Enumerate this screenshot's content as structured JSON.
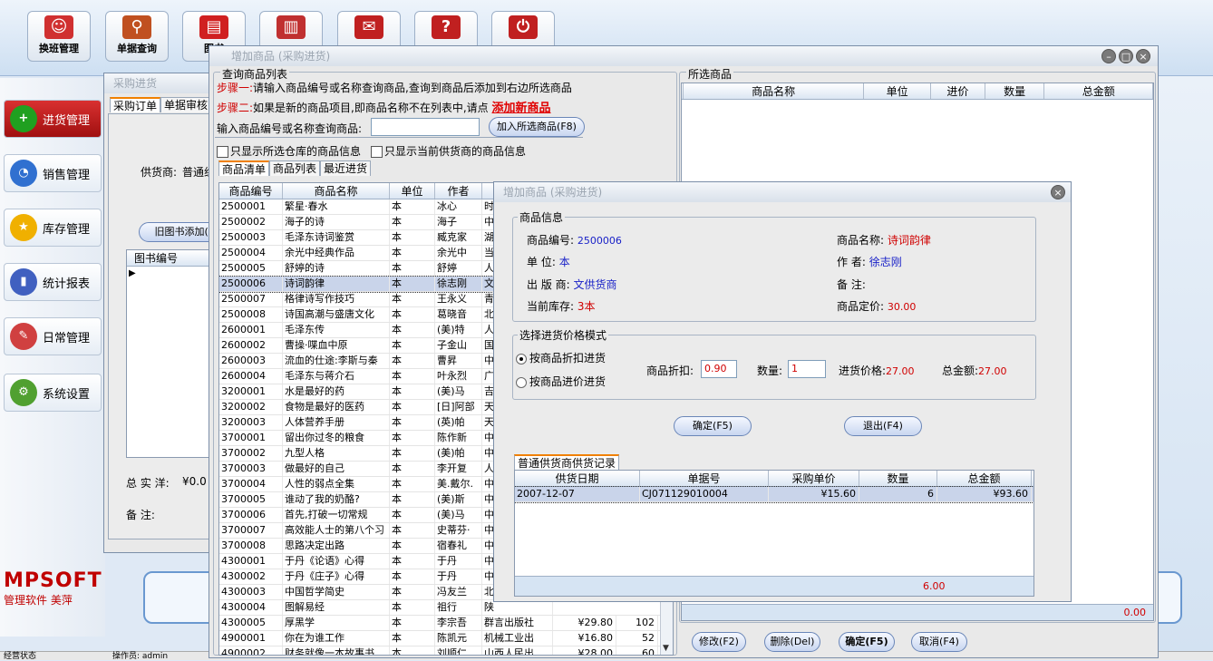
{
  "toolbar": [
    {
      "label": "换班管理",
      "icon": "user-icon",
      "color": "#d03030"
    },
    {
      "label": "单据查询",
      "icon": "search-icon",
      "color": "#c05020"
    },
    {
      "label": "图书",
      "icon": "book-icon",
      "color": "#d02020"
    },
    {
      "label": "",
      "icon": "chart-icon",
      "color": "#c03030"
    },
    {
      "label": "",
      "icon": "mail-icon",
      "color": "#c02020"
    },
    {
      "label": "",
      "icon": "help-icon",
      "color": "#c02020"
    },
    {
      "label": "",
      "icon": "power-icon",
      "color": "#c02020"
    }
  ],
  "sidebar": [
    {
      "label": "进货管理",
      "icon": "plus-icon",
      "color": "#20a020"
    },
    {
      "label": "销售管理",
      "icon": "pie-chart-icon",
      "color": "#3070d0"
    },
    {
      "label": "库存管理",
      "icon": "star-icon",
      "color": "#f0b000"
    },
    {
      "label": "统计报表",
      "icon": "bar-chart-icon",
      "color": "#4060c0"
    },
    {
      "label": "日常管理",
      "icon": "tools-icon",
      "color": "#d04040"
    },
    {
      "label": "系统设置",
      "icon": "gear-icon",
      "color": "#50a030"
    }
  ],
  "brand": {
    "logo": "MPSOFT",
    "subtitle": "管理软件 美萍"
  },
  "purchase": {
    "title": "采购进货",
    "tab1": "采购订单",
    "tab2": "单据审核",
    "supplier_label": "供货商:",
    "supplier_value": "普通组",
    "add_btn": "旧图书添加(F9)",
    "col_code": "图书编号",
    "total_label": "总 实 洋:",
    "total_value": "¥0.0",
    "note_label": "备     注:"
  },
  "status": {
    "left": "经营状态",
    "mid": "操作员: admin"
  },
  "add": {
    "title": "增加商品 (采购进货)",
    "query_group": "查询商品列表",
    "step1": "步骤一:",
    "step1_text": "请输入商品编号或名称查询商品,查询到商品后添加到右边所选商品",
    "step2": "步骤二:",
    "step2_text": "如果是新的商品项目,即商品名称不在列表中,请点",
    "add_new_link": "添加新商品",
    "search_label": "输入商品编号或名称查询商品:",
    "search_value": "",
    "add_selected_btn": "加入所选商品(F8)",
    "chk1": "只显示所选仓库的商品信息",
    "chk2": "只显示当前供货商的商品信息",
    "tabs": [
      "商品清单",
      "商品列表",
      "最近进货"
    ],
    "cols": [
      "商品编号",
      "商品名称",
      "单位",
      "作者",
      ""
    ],
    "rows": [
      [
        "2500001",
        "繁星·春水",
        "本",
        "冰心",
        "时"
      ],
      [
        "2500002",
        "海子的诗",
        "本",
        "海子",
        "中"
      ],
      [
        "2500003",
        "毛泽东诗词鉴赏",
        "本",
        "臧克家",
        "湖"
      ],
      [
        "2500004",
        "余光中经典作品",
        "本",
        "余光中",
        "当"
      ],
      [
        "2500005",
        "舒婷的诗",
        "本",
        "舒婷",
        "人"
      ],
      [
        "2500006",
        "诗词韵律",
        "本",
        "徐志刚",
        "文"
      ],
      [
        "2500007",
        "格律诗写作技巧",
        "本",
        "王永义",
        "青"
      ],
      [
        "2500008",
        "诗国高潮与盛唐文化",
        "本",
        "葛晓音",
        "北"
      ],
      [
        "2600001",
        "毛泽东传",
        "本",
        "(美)特",
        "人"
      ],
      [
        "2600002",
        "曹操·喋血中原",
        "本",
        "子金山",
        "国"
      ],
      [
        "2600003",
        "流血的仕途:李斯与秦",
        "本",
        "曹昇",
        "中"
      ],
      [
        "2600004",
        "毛泽东与蒋介石",
        "本",
        "叶永烈",
        "广"
      ],
      [
        "3200001",
        "水是最好的药",
        "本",
        "(美)马",
        "吉"
      ],
      [
        "3200002",
        "食物是最好的医药",
        "本",
        "[日]阿部",
        "天"
      ],
      [
        "3200003",
        "人体营养手册",
        "本",
        "(英)帕",
        "天"
      ],
      [
        "3700001",
        "留出你过冬的粮食",
        "本",
        "陈作新",
        "中"
      ],
      [
        "3700002",
        "九型人格",
        "本",
        "(美)帕",
        "中"
      ],
      [
        "3700003",
        "做最好的自己",
        "本",
        "李开复",
        "人"
      ],
      [
        "3700004",
        "人性的弱点全集",
        "本",
        "美.戴尔.",
        "中"
      ],
      [
        "3700005",
        "谁动了我的奶酪?",
        "本",
        "(美)斯",
        "中"
      ],
      [
        "3700006",
        "首先,打破一切常规",
        "本",
        "(美)马",
        "中"
      ],
      [
        "3700007",
        "高效能人士的第八个习",
        "本",
        "史蒂芬·",
        "中"
      ],
      [
        "3700008",
        "思路决定出路",
        "本",
        "宿春礼",
        "中"
      ],
      [
        "4300001",
        "于丹《论语》心得",
        "本",
        "于丹",
        "中"
      ],
      [
        "4300002",
        "于丹《庄子》心得",
        "本",
        "于丹",
        "中"
      ],
      [
        "4300003",
        "中国哲学简史",
        "本",
        "冯友兰",
        "北"
      ],
      [
        "4300004",
        "图解易经",
        "本",
        "祖行",
        "陕"
      ],
      [
        "4300005",
        "厚黑学",
        "本",
        "李宗吾",
        "群言出版社",
        "¥29.80",
        "102"
      ],
      [
        "4900001",
        "你在为谁工作",
        "本",
        "陈凯元",
        "机械工业出",
        "¥16.80",
        "52"
      ],
      [
        "4900002",
        "财务就像一本故事书",
        "本",
        "刘顺仁",
        "山西人民出",
        "¥28.00",
        "60"
      ]
    ],
    "selected_group": "所选商品",
    "sel_cols": [
      "商品名称",
      "单位",
      "进价",
      "数量",
      "总金额"
    ],
    "sel_total": "0.00",
    "btn_modify": "修改(F2)",
    "btn_delete": "删除(Del)",
    "btn_ok": "确定(F5)",
    "btn_cancel": "取消(F4)"
  },
  "detail": {
    "title": "增加商品 (采购进货)",
    "info_group": "商品信息",
    "code_label": "商品编号:",
    "code_value": "2500006",
    "name_label": "商品名称:",
    "name_value": "诗词韵律",
    "unit_label": "单     位:",
    "unit_value": "本",
    "author_label": "作     者:",
    "author_value": "徐志刚",
    "pub_label": "出 版 商:",
    "pub_value": "文供货商",
    "note_label": "备     注:",
    "stock_label": "当前库存:",
    "stock_value": "3本",
    "price_label": "商品定价:",
    "price_value": "30.00",
    "mode_group": "选择进货价格模式",
    "mode1": "按商品折扣进货",
    "mode2": "按商品进价进货",
    "discount_label": "商品折扣:",
    "discount_value": "0.90",
    "qty_label": "数量:",
    "qty_value": "1",
    "cost_label": "进货价格:",
    "cost_value": "27.00",
    "amount_label": "总金额:",
    "amount_value": "27.00",
    "ok_btn": "确定(F5)",
    "exit_btn": "退出(F4)",
    "hist_tab": "普通供货商供货记录",
    "hist_cols": [
      "供货日期",
      "单据号",
      "采购单价",
      "数量",
      "总金额"
    ],
    "hist_rows": [
      [
        "2007-12-07",
        "CJ071129010004",
        "¥15.60",
        "6",
        "¥93.60"
      ]
    ],
    "hist_total": "6.00"
  }
}
